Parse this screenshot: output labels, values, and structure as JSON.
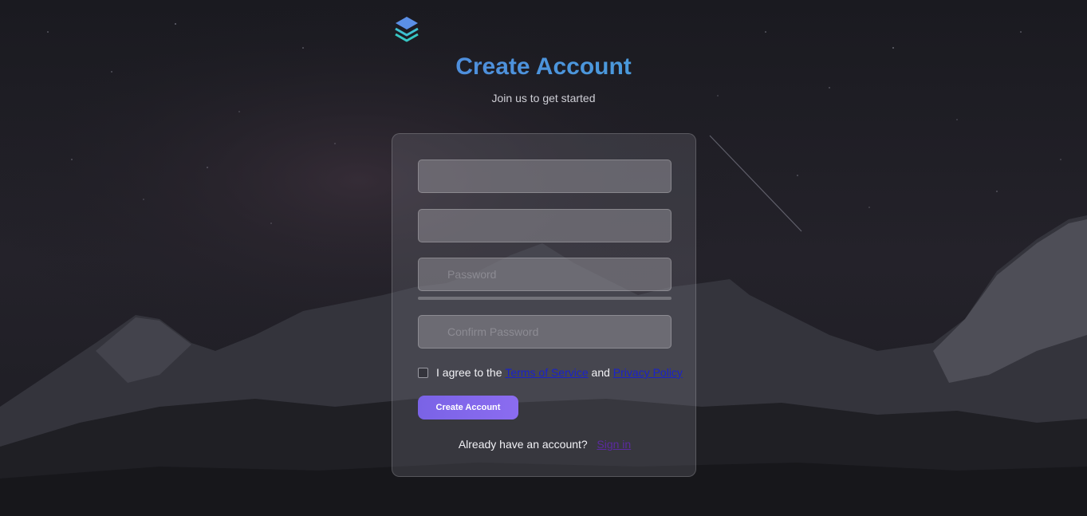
{
  "header": {
    "title": "Create Account",
    "subtitle": "Join us to get started"
  },
  "form": {
    "fields": [
      {
        "placeholder": "",
        "value": ""
      },
      {
        "placeholder": "",
        "value": ""
      },
      {
        "placeholder": "Password",
        "value": ""
      },
      {
        "placeholder": "Confirm Password",
        "value": ""
      }
    ],
    "agree": {
      "prefix": "I agree to the",
      "terms_label": "Terms of Service",
      "and": "and",
      "privacy_label": "Privacy Policy",
      "checked": false
    },
    "submit_label": "Create Account",
    "signin_prompt": "Already have an account?",
    "signin_label": "Sign in"
  },
  "icons": {
    "logo": "layers-icon"
  },
  "colors": {
    "title_gradient_start": "#5a72e0",
    "title_gradient_end": "#3fb6d8",
    "button": "#7a63e6",
    "link": "#1a22c8",
    "signin_link": "#5b2aa0"
  }
}
